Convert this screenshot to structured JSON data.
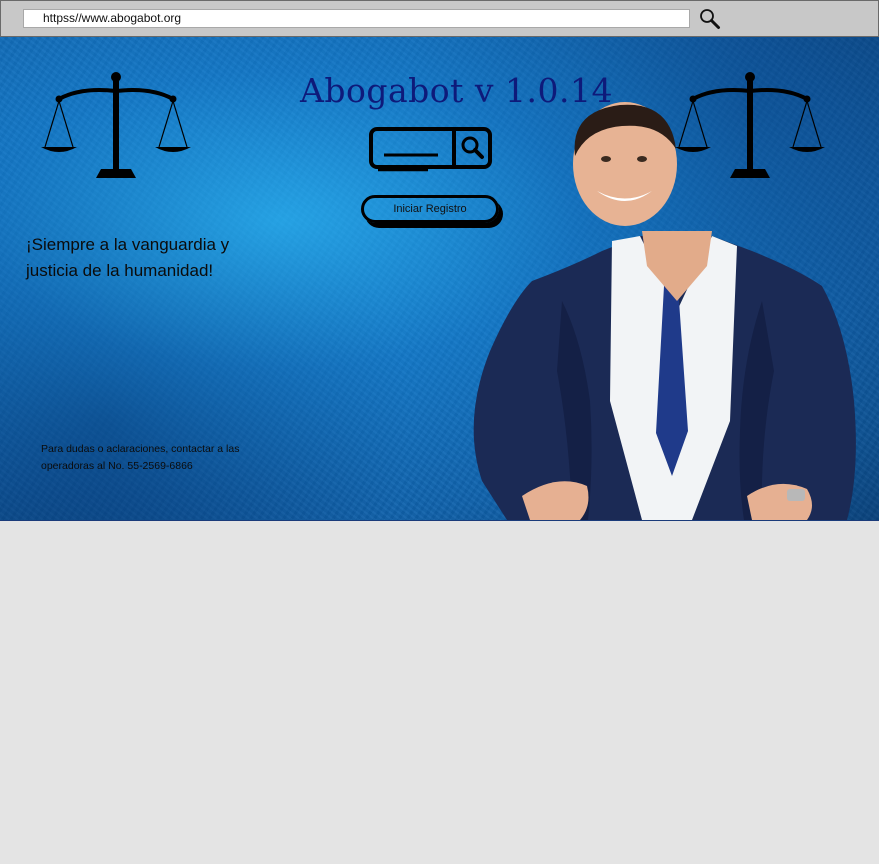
{
  "browser": {
    "url": "httpss//www.abogabot.org",
    "search_icon": "magnifier-icon"
  },
  "hero": {
    "title": "Abogabot v 1.0.14",
    "tagline": "¡Siempre a la vanguardia y justicia de la humanidad!",
    "register_button_label": "Iniciar Registro",
    "contact": "Para dudas o aclaraciones, contactar a las operadoras al No. 55-2569-6866",
    "icons": [
      "scales-of-justice-icon",
      "search-widget-icon",
      "magnifier-icon"
    ],
    "colors": {
      "title": "#0e1a7a",
      "background": "#1477c4",
      "page_background": "#e4e4e4"
    }
  }
}
